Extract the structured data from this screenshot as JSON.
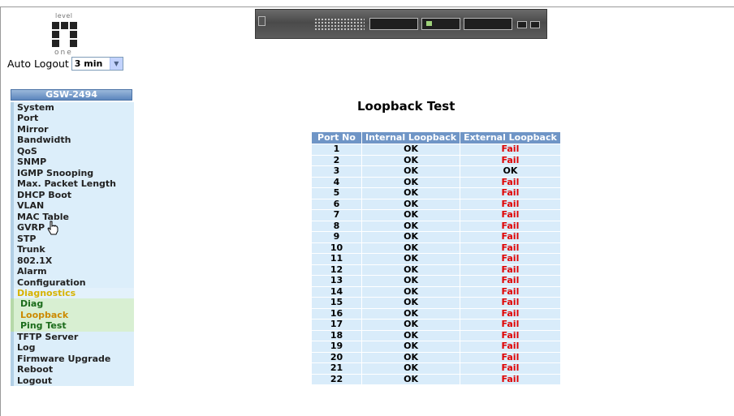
{
  "logo": {
    "top_text": "level",
    "bottom_text": "one"
  },
  "auto_logout": {
    "label": "Auto Logout",
    "value": "3 min"
  },
  "sidebar": {
    "title": "GSW-2494",
    "items": [
      {
        "label": "System",
        "type": "item"
      },
      {
        "label": "Port",
        "type": "item"
      },
      {
        "label": "Mirror",
        "type": "item"
      },
      {
        "label": "Bandwidth",
        "type": "item"
      },
      {
        "label": "QoS",
        "type": "item"
      },
      {
        "label": "SNMP",
        "type": "item"
      },
      {
        "label": "IGMP Snooping",
        "type": "item"
      },
      {
        "label": "Max. Packet Length",
        "type": "item"
      },
      {
        "label": "DHCP Boot",
        "type": "item"
      },
      {
        "label": "VLAN",
        "type": "item"
      },
      {
        "label": "MAC Table",
        "type": "item"
      },
      {
        "label": "GVRP",
        "type": "item"
      },
      {
        "label": "STP",
        "type": "item"
      },
      {
        "label": "Trunk",
        "type": "item"
      },
      {
        "label": "802.1X",
        "type": "item"
      },
      {
        "label": "Alarm",
        "type": "item"
      },
      {
        "label": "Configuration",
        "type": "item"
      },
      {
        "label": "Diagnostics",
        "type": "active"
      },
      {
        "label": "Diag",
        "type": "sub"
      },
      {
        "label": "Loopback",
        "type": "sub-current"
      },
      {
        "label": "Ping Test",
        "type": "sub"
      },
      {
        "label": "TFTP Server",
        "type": "item"
      },
      {
        "label": "Log",
        "type": "item"
      },
      {
        "label": "Firmware Upgrade",
        "type": "item"
      },
      {
        "label": "Reboot",
        "type": "item"
      },
      {
        "label": "Logout",
        "type": "item"
      }
    ]
  },
  "main": {
    "title": "Loopback Test",
    "columns": [
      "Port No",
      "Internal Loopback",
      "External Loopback"
    ],
    "rows": [
      [
        "1",
        "OK",
        "Fail"
      ],
      [
        "2",
        "OK",
        "Fail"
      ],
      [
        "3",
        "OK",
        "OK"
      ],
      [
        "4",
        "OK",
        "Fail"
      ],
      [
        "5",
        "OK",
        "Fail"
      ],
      [
        "6",
        "OK",
        "Fail"
      ],
      [
        "7",
        "OK",
        "Fail"
      ],
      [
        "8",
        "OK",
        "Fail"
      ],
      [
        "9",
        "OK",
        "Fail"
      ],
      [
        "10",
        "OK",
        "Fail"
      ],
      [
        "11",
        "OK",
        "Fail"
      ],
      [
        "12",
        "OK",
        "Fail"
      ],
      [
        "13",
        "OK",
        "Fail"
      ],
      [
        "14",
        "OK",
        "Fail"
      ],
      [
        "15",
        "OK",
        "Fail"
      ],
      [
        "16",
        "OK",
        "Fail"
      ],
      [
        "17",
        "OK",
        "Fail"
      ],
      [
        "18",
        "OK",
        "Fail"
      ],
      [
        "19",
        "OK",
        "Fail"
      ],
      [
        "20",
        "OK",
        "Fail"
      ],
      [
        "21",
        "OK",
        "Fail"
      ],
      [
        "22",
        "OK",
        "Fail"
      ]
    ]
  },
  "colors": {
    "header_bg": "#6f95c6",
    "cell_bg": "#d9ecfa",
    "fail": "#e00000",
    "active_menu": "#d7b300",
    "current_sub": "#cc8a00"
  }
}
